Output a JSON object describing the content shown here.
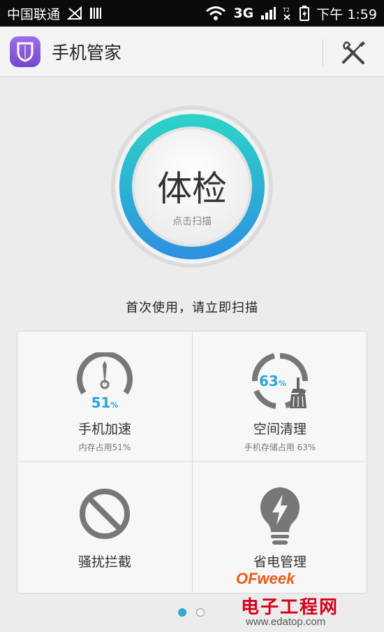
{
  "status_bar": {
    "carrier": "中国联通",
    "network": "3G",
    "time": "下午 1:59"
  },
  "app_bar": {
    "title": "手机管家",
    "logo_icon": "shield-icon",
    "tools_icon": "tools-icon"
  },
  "checkup": {
    "title": "体检",
    "subtitle": "点击扫描",
    "prompt": "首次使用，请立即扫描"
  },
  "tiles": {
    "speedup": {
      "title": "手机加速",
      "subtitle": "内存占用51%",
      "value": "51",
      "unit": "%",
      "icon": "speedometer-icon"
    },
    "cleanup": {
      "title": "空间清理",
      "subtitle": "手机存储占用 63%",
      "value": "63",
      "unit": "%",
      "icon": "broom-icon"
    },
    "block": {
      "title": "骚扰拦截",
      "icon": "block-icon"
    },
    "power": {
      "title": "省电管理",
      "icon": "power-bulb-icon"
    }
  },
  "pager": {
    "pages": 2,
    "active": 1
  },
  "watermark": {
    "brand": "OFweek",
    "name": "电子工程网",
    "url": "www.edatop.com"
  },
  "colors": {
    "accent": "#2eaad8",
    "ring_top": "#2cd0c8",
    "ring_bottom": "#2f8fe0",
    "number": "#2aa5d8",
    "logo": "#7d52d6"
  }
}
